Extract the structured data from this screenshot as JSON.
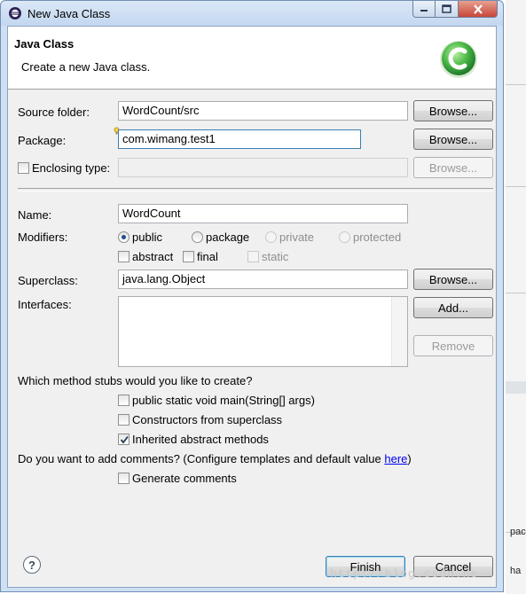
{
  "window": {
    "title": "New Java Class",
    "controls": {
      "minimize": "–",
      "maximize": "□",
      "close": "✕"
    }
  },
  "header": {
    "title": "Java Class",
    "description": "Create a new Java class.",
    "logo_letter": "C",
    "logo_color": "#3aa64a"
  },
  "source_folder": {
    "label": "Source folder:",
    "value": "WordCount/src",
    "browse": "Browse..."
  },
  "package": {
    "label": "Package:",
    "value": "com.wimang.test1",
    "browse": "Browse..."
  },
  "enclosing_type": {
    "label": "Enclosing type:",
    "value": "",
    "browse": "Browse...",
    "checked": false,
    "enabled": false
  },
  "name": {
    "label": "Name:",
    "value": "WordCount"
  },
  "modifiers": {
    "label": "Modifiers:",
    "access": [
      {
        "label": "public",
        "selected": true,
        "enabled": true
      },
      {
        "label": "package",
        "selected": false,
        "enabled": true
      },
      {
        "label": "private",
        "selected": false,
        "enabled": false
      },
      {
        "label": "protected",
        "selected": false,
        "enabled": false
      }
    ],
    "flags": [
      {
        "label": "abstract",
        "checked": false,
        "enabled": true
      },
      {
        "label": "final",
        "checked": false,
        "enabled": true
      },
      {
        "label": "static",
        "checked": false,
        "enabled": false
      }
    ]
  },
  "superclass": {
    "label": "Superclass:",
    "value": "java.lang.Object",
    "browse": "Browse..."
  },
  "interfaces": {
    "label": "Interfaces:",
    "add": "Add...",
    "remove": "Remove",
    "items": []
  },
  "stubs": {
    "question": "Which method stubs would you like to create?",
    "options": [
      {
        "label": "public static void main(String[] args)",
        "checked": false
      },
      {
        "label": "Constructors from superclass",
        "checked": false
      },
      {
        "label": "Inherited abstract methods",
        "checked": true
      }
    ]
  },
  "comments": {
    "question_prefix": "Do you want to add comments? (Configure templates and default value ",
    "link": "here",
    "question_suffix": ")",
    "option": {
      "label": "Generate comments",
      "checked": false
    }
  },
  "footer": {
    "help": "?",
    "finish": "Finish",
    "cancel": "Cancel"
  },
  "background": {
    "fragment_1": "pac",
    "fragment_2": "ha"
  },
  "watermark": "http://blog.csdn.ne"
}
